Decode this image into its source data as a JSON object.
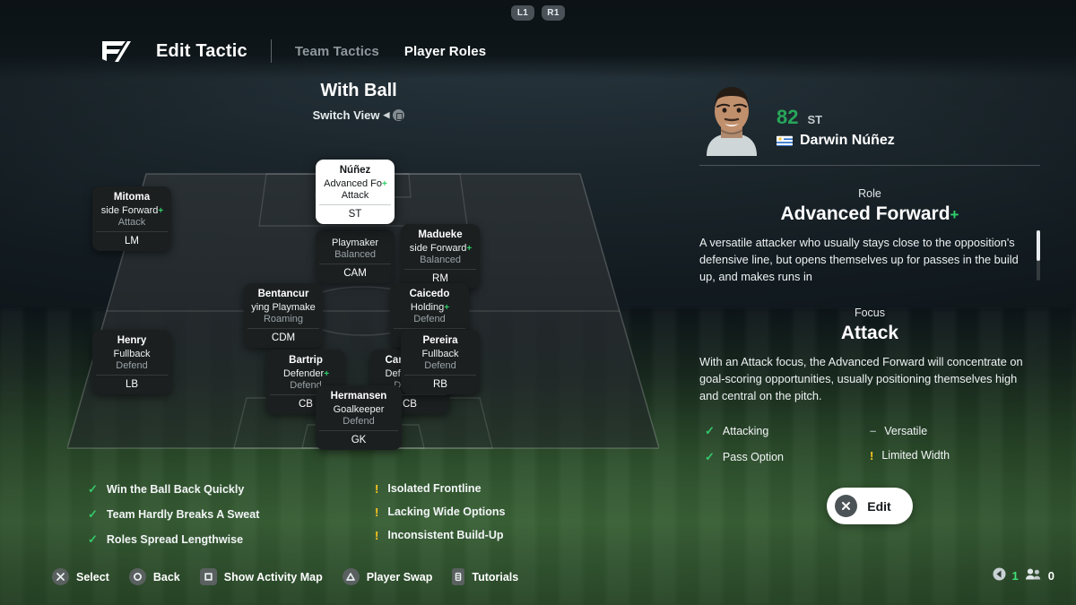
{
  "header": {
    "shoulder_left": "L1",
    "shoulder_right": "R1",
    "logo_name": "ea-fc-logo",
    "title": "Edit Tactic",
    "tabs": [
      {
        "label": "Team Tactics",
        "active": false
      },
      {
        "label": "Player Roles",
        "active": true
      }
    ]
  },
  "pitch_header": {
    "phase": "With Ball",
    "switch_view": "Switch View"
  },
  "formation": {
    "players": [
      {
        "name": "Mitoma",
        "role": "side Forward",
        "plus": 1,
        "focus": "Attack",
        "pos": "LM",
        "selected": false
      },
      {
        "name": "Núñez",
        "role": "Advanced Fo",
        "plus": 1,
        "focus": "Attack",
        "pos": "ST",
        "selected": true
      },
      {
        "name": "",
        "role": "Playmaker",
        "plus": 0,
        "focus": "Balanced",
        "pos": "CAM",
        "selected": false
      },
      {
        "name": "Madueke",
        "role": "side Forward",
        "plus": 1,
        "focus": "Balanced",
        "pos": "RM",
        "selected": false
      },
      {
        "name": "Bentancur",
        "role": "ying Playmake",
        "plus": 0,
        "focus": "Roaming",
        "pos": "CDM",
        "selected": false
      },
      {
        "name": "Caicedo",
        "role": "Holding",
        "plus": 1,
        "focus": "Defend",
        "pos": "CDM",
        "selected": false
      },
      {
        "name": "Henry",
        "role": "Fullback",
        "plus": 0,
        "focus": "Defend",
        "pos": "LB",
        "selected": false
      },
      {
        "name": "Bartrip",
        "role": "Defender",
        "plus": 1,
        "focus": "Defend",
        "pos": "CB",
        "selected": false
      },
      {
        "name": "Carragher",
        "role": "Defender",
        "plus": 2,
        "focus": "Defend",
        "pos": "CB",
        "selected": false
      },
      {
        "name": "Pereira",
        "role": "Fullback",
        "plus": 0,
        "focus": "Defend",
        "pos": "RB",
        "selected": false
      },
      {
        "name": "Hermansen",
        "role": "Goalkeeper",
        "plus": 0,
        "focus": "Defend",
        "pos": "GK",
        "selected": false
      }
    ]
  },
  "feedback": {
    "positives": [
      "Win the Ball Back Quickly",
      "Team Hardly Breaks A Sweat",
      "Roles Spread Lengthwise"
    ],
    "warnings": [
      "Isolated Frontline",
      "Lacking Wide Options",
      "Inconsistent Build-Up"
    ]
  },
  "prompts": [
    {
      "button": "cross",
      "label": "Select"
    },
    {
      "button": "circle",
      "label": "Back"
    },
    {
      "button": "square",
      "label": "Show Activity Map"
    },
    {
      "button": "triangle",
      "label": "Player Swap"
    },
    {
      "button": "options",
      "label": "Tutorials"
    }
  ],
  "counters": {
    "online": "1",
    "players": "0"
  },
  "player": {
    "rating": "82",
    "position": "ST",
    "name": "Darwin Núñez",
    "nation": "Uruguay",
    "role": {
      "label": "Role",
      "title": "Advanced Forward",
      "plus": "+",
      "description": "A versatile attacker who usually stays close to the opposition's defensive line, but opens themselves up for passes in the build up, and makes runs in"
    },
    "focus": {
      "label": "Focus",
      "title": "Attack",
      "description": "With an Attack focus, the Advanced Forward will concentrate on goal-scoring opportunities, usually positioning themselves high and central on the pitch."
    },
    "traits": [
      {
        "label": "Attacking",
        "type": "check"
      },
      {
        "label": "Pass Option",
        "type": "check"
      },
      {
        "label": "Versatile",
        "type": "dash"
      },
      {
        "label": "Limited Width",
        "type": "warn"
      }
    ],
    "edit_label": "Edit"
  },
  "colors": {
    "green_accent": "#2fd06a",
    "rating_green": "#27a65a",
    "warn_yellow": "#ffc61e",
    "card_dark": "#1b1f20"
  }
}
